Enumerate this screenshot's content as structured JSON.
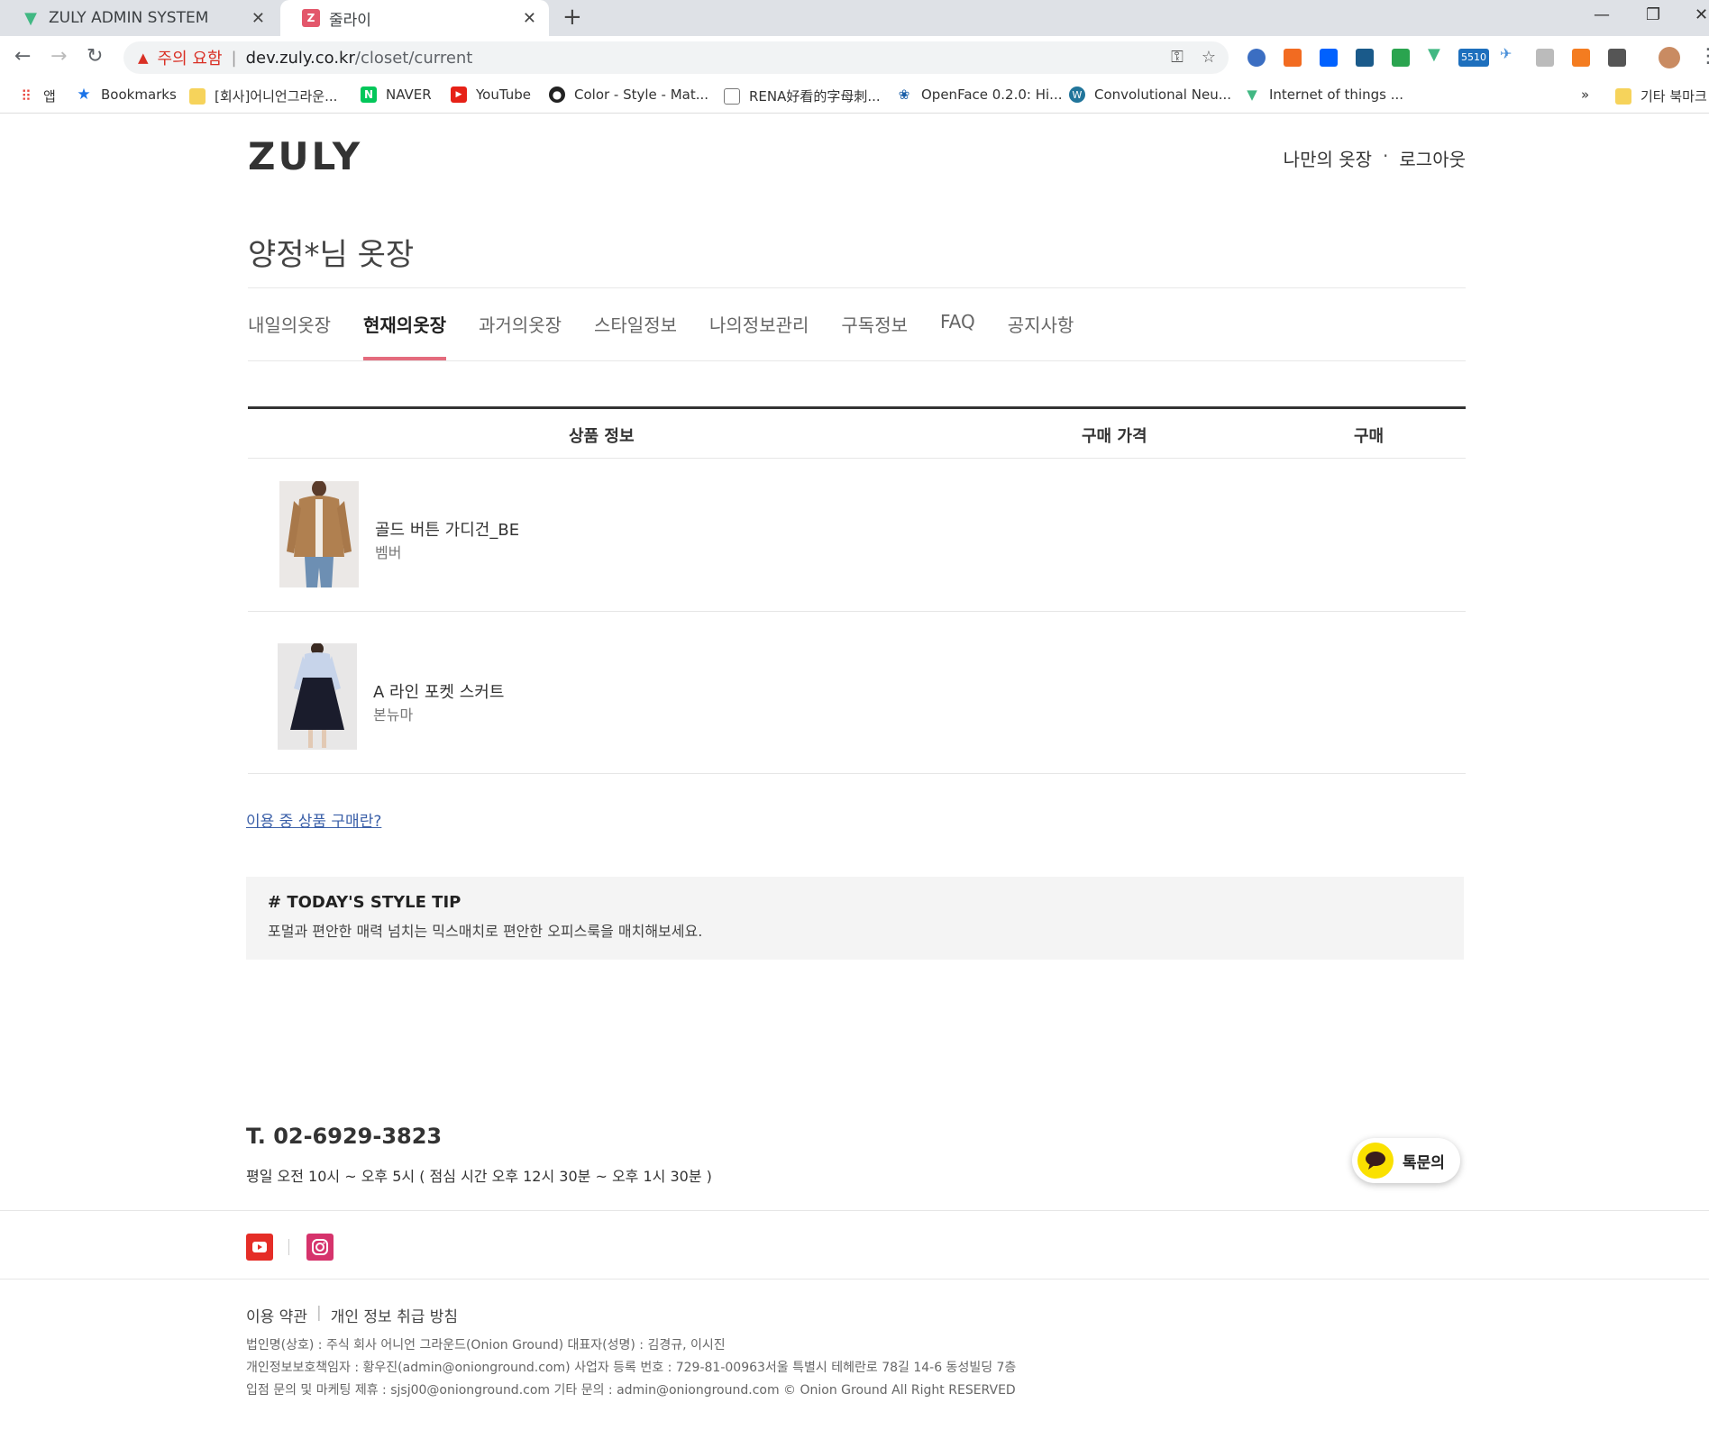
{
  "browser": {
    "tabs": [
      {
        "title": "ZULY ADMIN SYSTEM",
        "favicon": "vue-icon"
      },
      {
        "title": "줄라이",
        "favicon": "zuly-icon"
      }
    ],
    "address": {
      "warning": "주의 요함",
      "host": "dev.zuly.co.kr",
      "path": "/closet/current"
    },
    "bookmarks": [
      {
        "label": "앱",
        "icon": "apps-icon"
      },
      {
        "label": "Bookmarks",
        "icon": "star-icon"
      },
      {
        "label": "[회사]어니언그라운...",
        "icon": "folder-icon"
      },
      {
        "label": "NAVER",
        "icon": "naver-icon"
      },
      {
        "label": "YouTube",
        "icon": "youtube-icon"
      },
      {
        "label": "Color - Style - Mat...",
        "icon": "github-icon"
      },
      {
        "label": "RENA好看的字母刺...",
        "icon": "page-icon"
      },
      {
        "label": "OpenFace 0.2.0: Hi...",
        "icon": "paw-icon"
      },
      {
        "label": "Convolutional Neu...",
        "icon": "wordpress-icon"
      },
      {
        "label": "Internet of things ...",
        "icon": "vue-icon"
      },
      {
        "label": "»",
        "icon": ""
      },
      {
        "label": "기타 북마크",
        "icon": "folder-icon"
      }
    ],
    "ext_badge": "5510"
  },
  "header": {
    "logo": "ZULY",
    "nav": [
      "나만의 옷장",
      "·",
      "로그아웃"
    ]
  },
  "page_title": "양정*님 옷장",
  "tabs": [
    {
      "label": "내일의옷장",
      "active": false
    },
    {
      "label": "현재의옷장",
      "active": true
    },
    {
      "label": "과거의옷장",
      "active": false
    },
    {
      "label": "스타일정보",
      "active": false
    },
    {
      "label": "나의정보관리",
      "active": false
    },
    {
      "label": "구독정보",
      "active": false
    },
    {
      "label": "FAQ",
      "active": false
    },
    {
      "label": "공지사항",
      "active": false
    }
  ],
  "table": {
    "headers": [
      "상품 정보",
      "구매 가격",
      "구매"
    ],
    "rows": [
      {
        "name": "골드 버튼 가디건_BE",
        "brand": "벰버"
      },
      {
        "name": "A 라인 포켓 스커트",
        "brand": "본뉴마"
      }
    ]
  },
  "purchase_link": "이용 중 상품 구매란?",
  "style_tip": {
    "title": "# TODAY'S STYLE TIP",
    "text": "포멀과 편안한 매력 넘치는 믹스매치로 편안한 오피스룩을 매치해보세요."
  },
  "footer": {
    "phone": "T. 02-6929-3823",
    "hours": "평일 오전 10시 ~ 오후 5시 ( 점심 시간 오후 12시 30분 ~ 오후 1시 30분 )",
    "kakao": "톡문의",
    "links": [
      "이용 약관",
      "개인 정보 취급 방침"
    ],
    "info": [
      "법인명(상호) : 주식 회사 어니언 그라운드(Onion Ground) 대표자(성명) : 김경규, 이시진",
      "개인정보보호책임자 : 황우진(admin@onionground.com) 사업자 등록 번호 : 729-81-00963서울 특별시 테헤란로 78길 14-6 동성빌딩 7층",
      "입점 문의 및 마케팅 제휴 : sjsj00@onionground.com 기타 문의 : admin@onionground.com © Onion Ground All Right RESERVED"
    ]
  },
  "colors": {
    "accent": "#e46b7d",
    "link": "#3a5fa8",
    "kakao": "#fae100"
  }
}
